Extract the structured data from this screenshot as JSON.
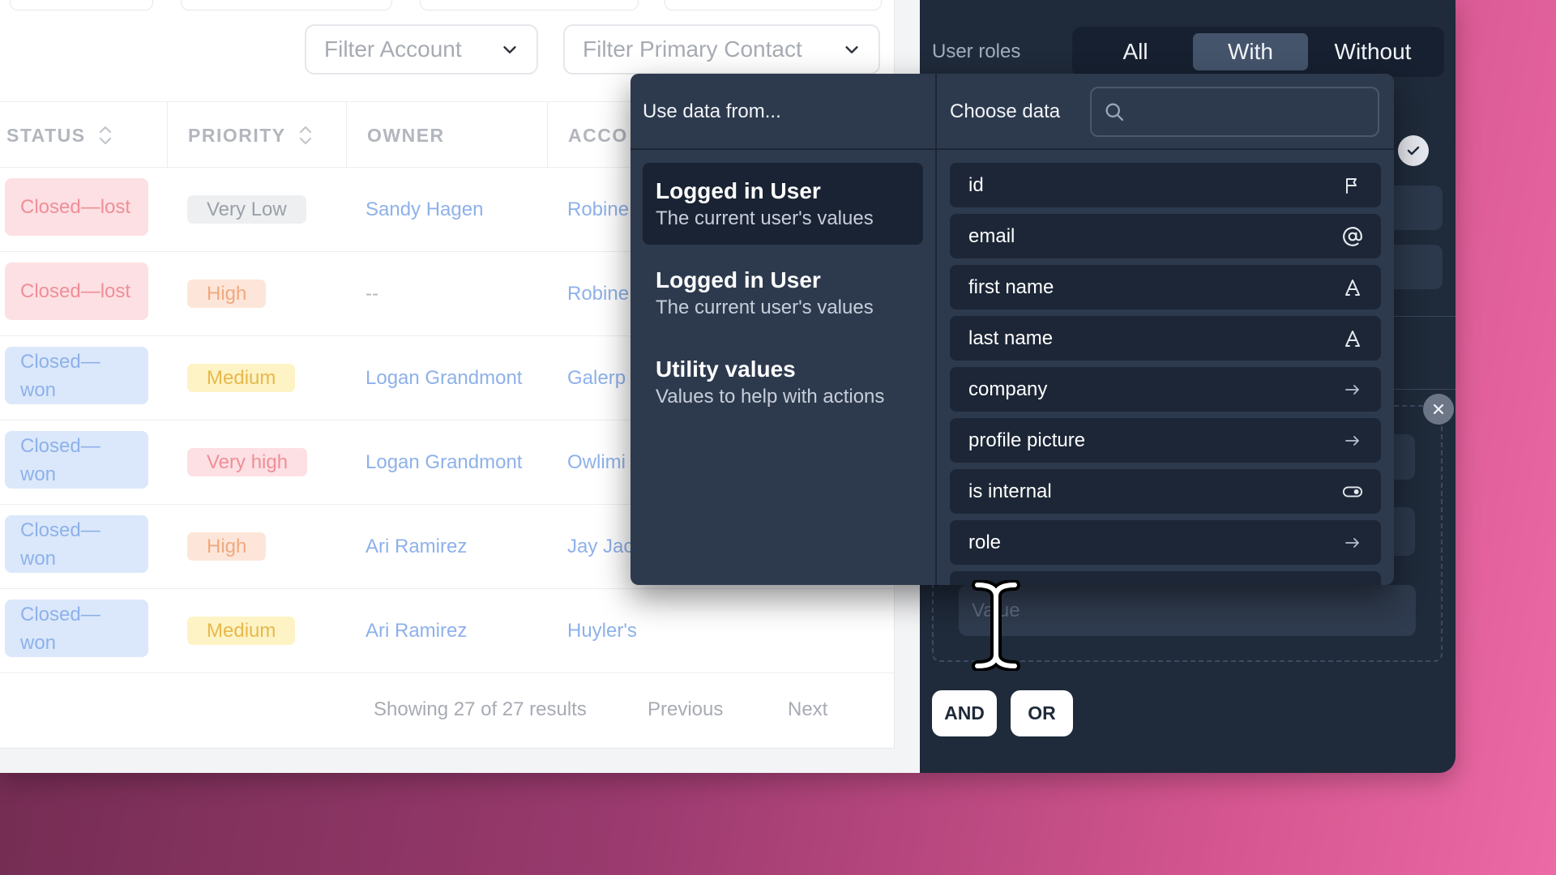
{
  "filters": {
    "account_placeholder": "Filter Account",
    "contact_placeholder": "Filter Primary Contact"
  },
  "table": {
    "headers": {
      "status": "STATUS",
      "priority": "PRIORITY",
      "owner": "OWNER",
      "account": "ACCO"
    },
    "rows": [
      {
        "status": "Closed—lost",
        "priority": "Very Low",
        "owner": "Sandy Hagen",
        "account": "Robine"
      },
      {
        "status": "Closed—lost",
        "priority": "High",
        "owner": "--",
        "account": "Robine"
      },
      {
        "status": "Closed—won",
        "priority": "Medium",
        "owner": "Logan Grandmont",
        "account": "Galerp"
      },
      {
        "status": "Closed—won",
        "priority": "Very high",
        "owner": "Logan Grandmont",
        "account": "Owlimi"
      },
      {
        "status": "Closed—won",
        "priority": "High",
        "owner": "Ari Ramirez",
        "account": "Jay Jac"
      },
      {
        "status": "Closed—won",
        "priority": "Medium",
        "owner": "Ari Ramirez",
        "account": "Huyler's"
      }
    ],
    "footer": {
      "results": "Showing 27 of 27 results",
      "previous": "Previous",
      "next": "Next"
    }
  },
  "panel": {
    "roles_label": "User roles",
    "segments": [
      "All",
      "With",
      "Without"
    ],
    "active_segment": "With",
    "value_placeholder": "Value",
    "and_label": "AND",
    "or_label": "OR"
  },
  "dropdown": {
    "use_data_from": "Use data from...",
    "choose_data": "Choose data",
    "search_value": "",
    "sources": [
      {
        "title": "Logged in User",
        "subtitle": "The current user's values"
      },
      {
        "title": "Logged in User",
        "subtitle": "The current user's values"
      },
      {
        "title": "Utility values",
        "subtitle": "Values to help with actions"
      }
    ],
    "fields": [
      {
        "label": "id",
        "icon": "flag-icon"
      },
      {
        "label": "email",
        "icon": "at-sign-icon"
      },
      {
        "label": "first name",
        "icon": "text-a-icon"
      },
      {
        "label": "last name",
        "icon": "text-a-icon"
      },
      {
        "label": "company",
        "icon": "arrow-right-icon"
      },
      {
        "label": "profile picture",
        "icon": "arrow-right-icon"
      },
      {
        "label": "is internal",
        "icon": "toggle-icon"
      },
      {
        "label": "role",
        "icon": "arrow-right-icon"
      }
    ]
  },
  "colors": {
    "panel_bg": "#1f2a3a",
    "dropdown_bg": "#2d3a4e",
    "link_blue": "#8eb1ea",
    "status_lost_bg": "#fde0e3",
    "status_won_bg": "#dbe8fb"
  }
}
